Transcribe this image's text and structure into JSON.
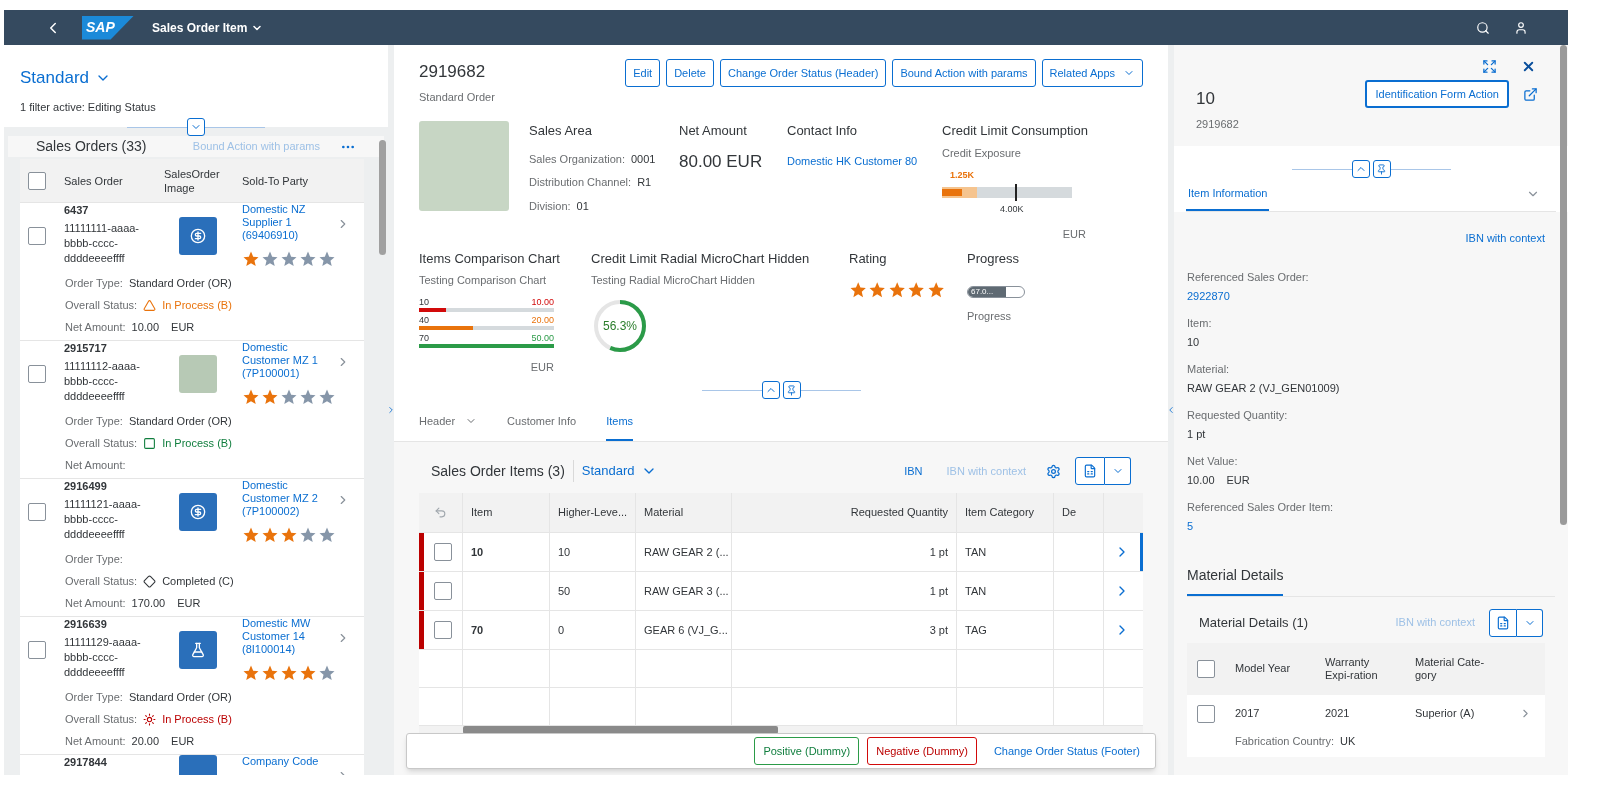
{
  "shell": {
    "logo": "SAP",
    "title": "Sales Order Item"
  },
  "list_report": {
    "variant": "Standard",
    "filter_info": "1 filter active: Editing Status",
    "table_title": "Sales Orders (33)",
    "action": {
      "label": "Bound Action with params",
      "disabled": true
    },
    "select_all_checked": false,
    "columns": [
      "Sales Order",
      "SalesOrder Image",
      "Sold-To Party"
    ],
    "rows": [
      {
        "checked": false,
        "number": "6437",
        "uuid": "11111111-aaaa-bbbb-cccc-ddddeeeeffff",
        "image": {
          "kind": "money"
        },
        "party": "Domestic NZ Supplier 1 (69406910)",
        "stars": 1,
        "details": [
          {
            "kind": "text",
            "label": "Order Type:",
            "value": "Standard Order (OR)"
          },
          {
            "kind": "status",
            "label": "Overall Status:",
            "status": {
              "kind": "warning",
              "text": "In Process (B)"
            }
          },
          {
            "kind": "amount",
            "label": "Net Amount:",
            "value": "10.00",
            "unit": "EUR"
          }
        ]
      },
      {
        "checked": false,
        "number": "2915717",
        "uuid": "11111112-aaaa-bbbb-cccc-ddddeeeeffff",
        "image": {
          "kind": "photo"
        },
        "party": "Domestic Customer MZ 1 (7P100001)",
        "stars": 2,
        "details": [
          {
            "kind": "text",
            "label": "Order Type:",
            "value": "Standard Order (OR)"
          },
          {
            "kind": "status",
            "label": "Overall Status:",
            "status": {
              "kind": "success",
              "text": "In Process (B)"
            }
          },
          {
            "kind": "amount",
            "label": "Net Amount:"
          }
        ]
      },
      {
        "checked": false,
        "number": "2916499",
        "uuid": "11111121-aaaa-bbbb-cccc-ddddeeeeffff",
        "image": {
          "kind": "money"
        },
        "party": "Domestic Customer MZ 2 (7P100002)",
        "stars": 3,
        "details": [
          {
            "kind": "text",
            "label": "Order Type:"
          },
          {
            "kind": "status",
            "label": "Overall Status:",
            "status": {
              "kind": "none",
              "text": "Completed (C)"
            }
          },
          {
            "kind": "amount",
            "label": "Net Amount:",
            "value": "170.00",
            "unit": "EUR"
          }
        ]
      },
      {
        "checked": false,
        "number": "2916639",
        "uuid": "11111129-aaaa-bbbb-cccc-ddddeeeeffff",
        "image": {
          "kind": "flask"
        },
        "party": "Domestic MW Customer 14 (8I100014)",
        "stars": 4,
        "details": [
          {
            "kind": "text",
            "label": "Order Type:",
            "value": "Standard Order (OR)"
          },
          {
            "kind": "status",
            "label": "Overall Status:",
            "status": {
              "kind": "error",
              "text": "In Process (B)"
            }
          },
          {
            "kind": "amount",
            "label": "Net Amount:",
            "value": "20.00",
            "unit": "EUR"
          }
        ]
      },
      {
        "number": "2917844",
        "image": {
          "kind": "blank"
        },
        "party": "Company Code"
      }
    ]
  },
  "header": {
    "title": "2919682",
    "subtitle": "Standard Order",
    "actions": [
      {
        "label": "Edit",
        "menu": false
      },
      {
        "label": "Delete",
        "menu": false
      },
      {
        "label": "Change Order Status (Header)",
        "menu": false
      },
      {
        "label": "Bound Action with params",
        "menu": false
      },
      {
        "label": "Related Apps",
        "menu": true
      }
    ],
    "sales_area": {
      "title": "Sales Area",
      "fields": [
        {
          "label": "Sales Organization:",
          "value": "0001"
        },
        {
          "label": "Distribution Channel:",
          "value": "R1"
        },
        {
          "label": "Division:",
          "value": "01"
        }
      ]
    },
    "net_amount": {
      "title": "Net Amount",
      "value": "80.00 EUR"
    },
    "contact": {
      "title": "Contact Info",
      "link": "Domestic HK Customer 80"
    },
    "credit_limit": {
      "title": "Credit Limit Consumption",
      "subtitle": "Credit Exposure",
      "value_label": "1.25K",
      "level": 0.15,
      "target_label": "4.00K",
      "unit": "EUR"
    },
    "comparison": {
      "title": "Items Comparison Chart",
      "subtitle": "Testing Comparison Chart",
      "unit": "EUR",
      "bars": [
        {
          "label": "10",
          "value": "10.00",
          "level": 0.2,
          "color": "#d20a0a"
        },
        {
          "label": "40",
          "value": "20.00",
          "level": 0.4,
          "color": "#e9730c"
        },
        {
          "label": "70",
          "value": "50.00",
          "level": 1,
          "color": "#2b9b48"
        }
      ]
    },
    "radial": {
      "title": "Credit Limit Radial MicroChart Hidden",
      "subtitle": "Testing Radial MicroChart Hidden",
      "value": "56.3%",
      "level": 0.563
    },
    "rating": {
      "title": "Rating",
      "stars": 5
    },
    "progress": {
      "title": "Progress",
      "value": "67.0...",
      "level": 0.67,
      "label": "Progress"
    }
  },
  "anchor_tabs": [
    {
      "label": "Header",
      "menu": true,
      "selected": false
    },
    {
      "label": "Customer Info",
      "menu": false,
      "selected": false
    },
    {
      "label": "Items",
      "menu": false,
      "selected": true
    }
  ],
  "items_table": {
    "title": "Sales Order Items (3)",
    "variant": "Standard",
    "actions": [
      {
        "label": "IBN",
        "disabled": false
      },
      {
        "label": "IBN with context",
        "disabled": true
      }
    ],
    "columns": [
      "Item",
      "Higher-Leve...",
      "Material",
      "Requested Quantity",
      "Item Category",
      "De"
    ],
    "rows": [
      {
        "checked": false,
        "color": "#bb0000",
        "navigated": true,
        "item": "10",
        "higher_level": "10",
        "material": "RAW GEAR 2 (...",
        "quantity": "1 pt",
        "category": "TAN"
      },
      {
        "checked": false,
        "color": "#bb0000",
        "navigated": false,
        "higher_level": "50",
        "material": "RAW GEAR 3 (...",
        "quantity": "1 pt",
        "category": "TAN"
      },
      {
        "checked": false,
        "color": "#bb0000",
        "navigated": false,
        "item": "70",
        "higher_level": "0",
        "material": "GEAR 6 (VJ_G...",
        "quantity": "3 pt",
        "category": "TAG"
      }
    ]
  },
  "footer": {
    "actions": [
      {
        "label": "Positive (Dummy)",
        "kind": "accept"
      },
      {
        "label": "Negative (Dummy)",
        "kind": "reject"
      },
      {
        "label": "Change Order Status (Footer)",
        "kind": "transparent"
      }
    ]
  },
  "detail": {
    "title": "10",
    "subtitle": "2919682",
    "action": "Identification Form Action",
    "tabs": [
      {
        "label": "Item Information",
        "selected": true
      }
    ],
    "link": "IBN with context",
    "fields": [
      {
        "kind": "link",
        "label": "Referenced Sales Order:",
        "value": "2922870"
      },
      {
        "kind": "text",
        "label": "Item:",
        "value": "10"
      },
      {
        "kind": "text",
        "label": "Material:",
        "value": "RAW GEAR 2 (VJ_GEN01009)"
      },
      {
        "kind": "text",
        "label": "Requested Quantity:",
        "value": "1 pt"
      },
      {
        "kind": "amount",
        "label": "Net Value:",
        "value": "10.00",
        "unit": "EUR"
      },
      {
        "kind": "link",
        "label": "Referenced Sales Order Item:",
        "value": "5"
      }
    ],
    "section": {
      "title": "Material Details",
      "selected": true
    },
    "table": {
      "title": "Material Details (1)",
      "action": {
        "label": "IBN with context",
        "disabled": true
      },
      "select_all_checked": false,
      "columns": [
        "Model Year",
        "Warranty Expi-ration",
        "Material Cate-gory"
      ],
      "rows": [
        {
          "checked": false,
          "cells": [
            "2017",
            "2021",
            "Superior (A)"
          ],
          "extra": {
            "label": "Fabrication Country:",
            "value": "UK"
          }
        }
      ]
    }
  }
}
